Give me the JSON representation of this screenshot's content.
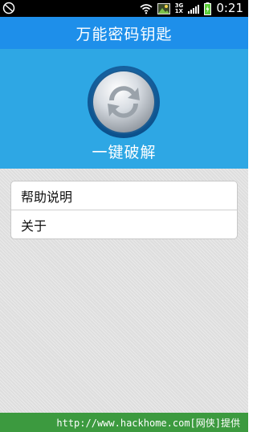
{
  "status_bar": {
    "time": "0:21",
    "network_top": "3G",
    "network_bottom": "1X",
    "icons": [
      "blocked-icon",
      "wifi-icon",
      "photo-icon",
      "signal-icon",
      "battery-charging-icon"
    ]
  },
  "app": {
    "title": "万能密码钥匙"
  },
  "hero": {
    "button_icon": "refresh-icon",
    "button_label": "一键破解"
  },
  "menu": {
    "items": [
      {
        "label": "帮助说明"
      },
      {
        "label": "关于"
      }
    ]
  },
  "footer": {
    "watermark": "http://www.hackhome.com[网侠]提供"
  },
  "colors": {
    "title_bar": "#1e8fea",
    "hero_bg": "#2ea7e4",
    "footer_bg": "#3c9a3f"
  }
}
